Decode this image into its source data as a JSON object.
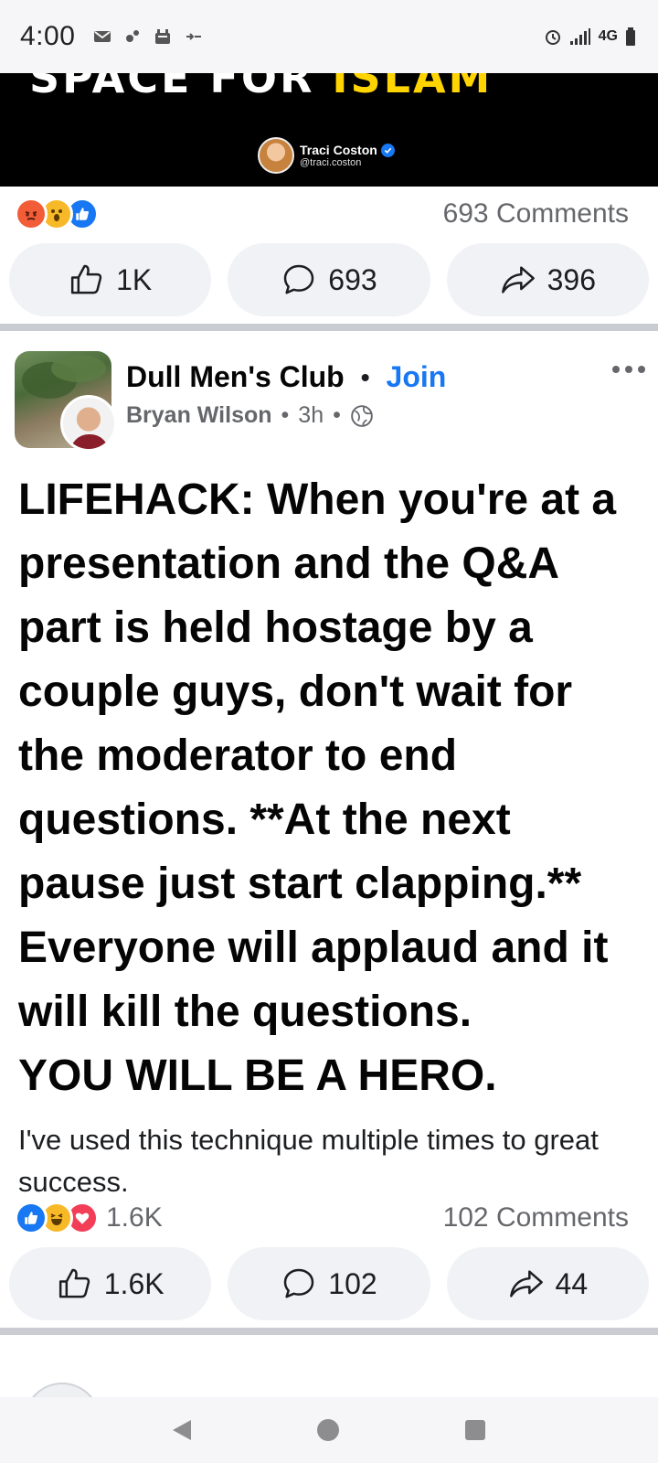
{
  "status_bar": {
    "time": "4:00",
    "network": "4G"
  },
  "video": {
    "overlay_text_white": "SPACE FOR ",
    "overlay_text_highlight": "ISLAM",
    "creator_name": "Traci Coston",
    "creator_handle": "@traci.coston"
  },
  "prev_post": {
    "reactions": [
      "angry",
      "wow",
      "like"
    ],
    "comments_label": "693 Comments",
    "like_count": "1K",
    "comment_count": "693",
    "share_count": "396"
  },
  "post": {
    "group_name": "Dull Men's Club",
    "join_label": "Join",
    "author": "Bryan Wilson",
    "time": "3h",
    "audience_icon": "globe-icon",
    "body_lines": [
      "LIFEHACK: When you're at a",
      "presentation and the Q&A",
      "part is held hostage by a",
      "couple guys, don't wait for",
      "the moderator to end",
      "questions. **At the next",
      "pause just start clapping.**",
      "Everyone will applaud and it",
      "will kill the questions.",
      "YOU WILL BE A HERO."
    ],
    "sub_text": "I've used this technique multiple times to great success.",
    "reactions": [
      "like",
      "haha",
      "love"
    ],
    "reaction_count": "1.6K",
    "comments_label": "102 Comments",
    "like_count": "1.6K",
    "comment_count": "102",
    "share_count": "44"
  },
  "colors": {
    "facebook_blue": "#1877f2",
    "secondary_text": "#65676b",
    "button_bg": "#f0f2f5",
    "angry": "#f25d38",
    "love": "#f33e58",
    "wow_haha": "#f7b928"
  }
}
